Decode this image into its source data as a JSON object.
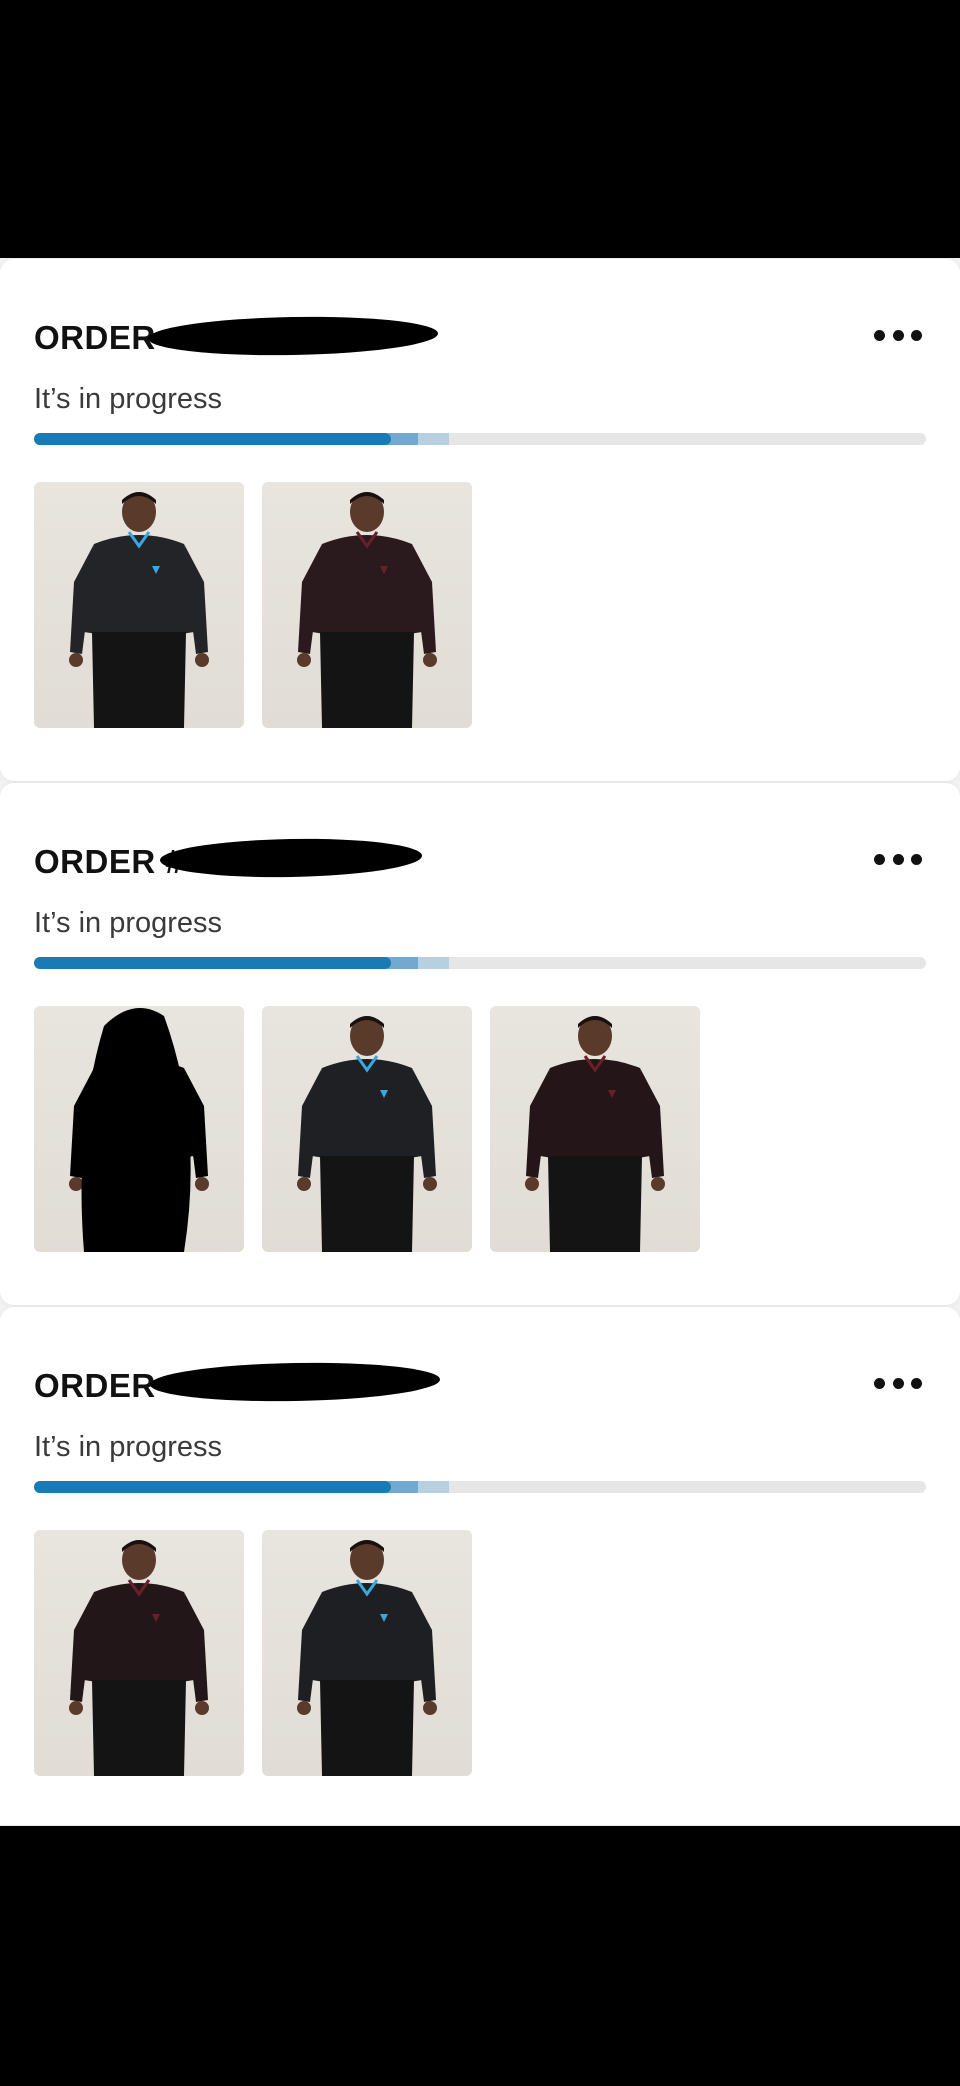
{
  "orders": [
    {
      "title": "ORDER",
      "status": "It’s in progress",
      "progress": {
        "done": 0.4,
        "segment2": 0.43,
        "segment3": 0.465
      },
      "items": [
        {
          "name": "product-image-hoodie-blue-zip",
          "shirt": "#222428",
          "accent": "#3aa7e0"
        },
        {
          "name": "product-image-hoodie-burgundy",
          "shirt": "#2a1a1d",
          "accent": "#6b1f2a"
        }
      ]
    },
    {
      "title": "ORDER #",
      "status": "It’s in progress",
      "progress": {
        "done": 0.4,
        "segment2": 0.43,
        "segment3": 0.465
      },
      "items": [
        {
          "name": "product-image-redacted",
          "shirt": "#000000",
          "accent": "#000000"
        },
        {
          "name": "product-image-longsleeve-black",
          "shirt": "#1e2024",
          "accent": "#3aa7e0"
        },
        {
          "name": "product-image-longsleeve-burgundy",
          "shirt": "#241618",
          "accent": "#6b1f2a"
        }
      ]
    },
    {
      "title": "ORDER",
      "status": "It’s in progress",
      "progress": {
        "done": 0.4,
        "segment2": 0.43,
        "segment3": 0.465
      },
      "items": [
        {
          "name": "product-image-tee-burgundy",
          "shirt": "#231618",
          "accent": "#6b1f2a"
        },
        {
          "name": "product-image-tee-black",
          "shirt": "#1d1f23",
          "accent": "#3aa7e0"
        }
      ]
    }
  ],
  "colors": {
    "accent": "#1a7ab6",
    "track": "#e6e6e6"
  },
  "icons": {
    "more": "more-horizontal-icon"
  }
}
